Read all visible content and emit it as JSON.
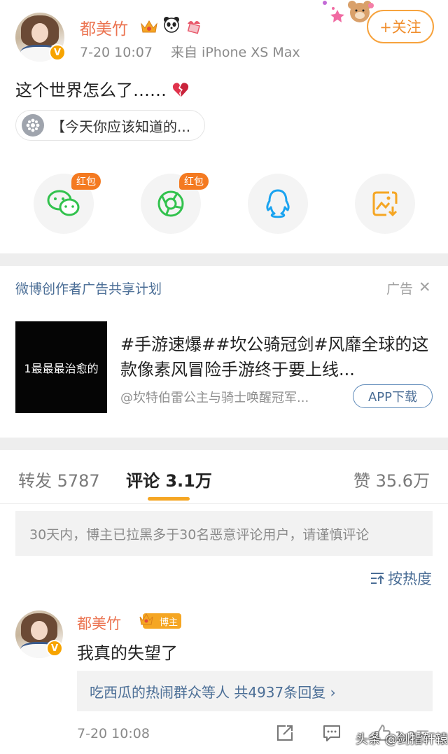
{
  "post": {
    "author": "都美竹",
    "time": "7-20 10:07",
    "source": "来自 iPhone XS Max",
    "follow_label": "+关注",
    "text": "这个世界怎么了……",
    "link_card": "【今天你应该知道的..."
  },
  "share": {
    "hongbao_label": "红包",
    "buttons": [
      "wechat-icon",
      "moments-icon",
      "qq-icon",
      "save-image-icon"
    ]
  },
  "ad": {
    "header": "微博创作者广告共享计划",
    "tag": "广告",
    "close": "✕",
    "thumb_text": "1最最最治愈的",
    "title": "#手游速爆##坎公骑冠剑#风靡全球的这款像素风冒险手游终于要上线...",
    "subtitle": "@坎特伯雷公主与骑士唤醒冠军...",
    "app_button": "APP下载"
  },
  "tabs": {
    "repost": "转发 5787",
    "comments": "评论 3.1万",
    "likes": "赞 35.6万"
  },
  "notice": "30天内，博主已拉黑多于30名恶意评论用户，请谨慎评论",
  "sort_label": "按热度",
  "comment": {
    "author": "都美竹",
    "badge": "博主",
    "text": "我真的失望了",
    "reply_summary": "吃西瓜的热闹群众等人  共4937条回复 ›",
    "time": "7-20 10:08",
    "likes": "1.2万"
  },
  "watermark": "头条 @剑指轩辕",
  "colors": {
    "name": "#eb7350",
    "link": "#4b6e96",
    "accent": "#f5a623",
    "follow": "#f08d2b"
  }
}
